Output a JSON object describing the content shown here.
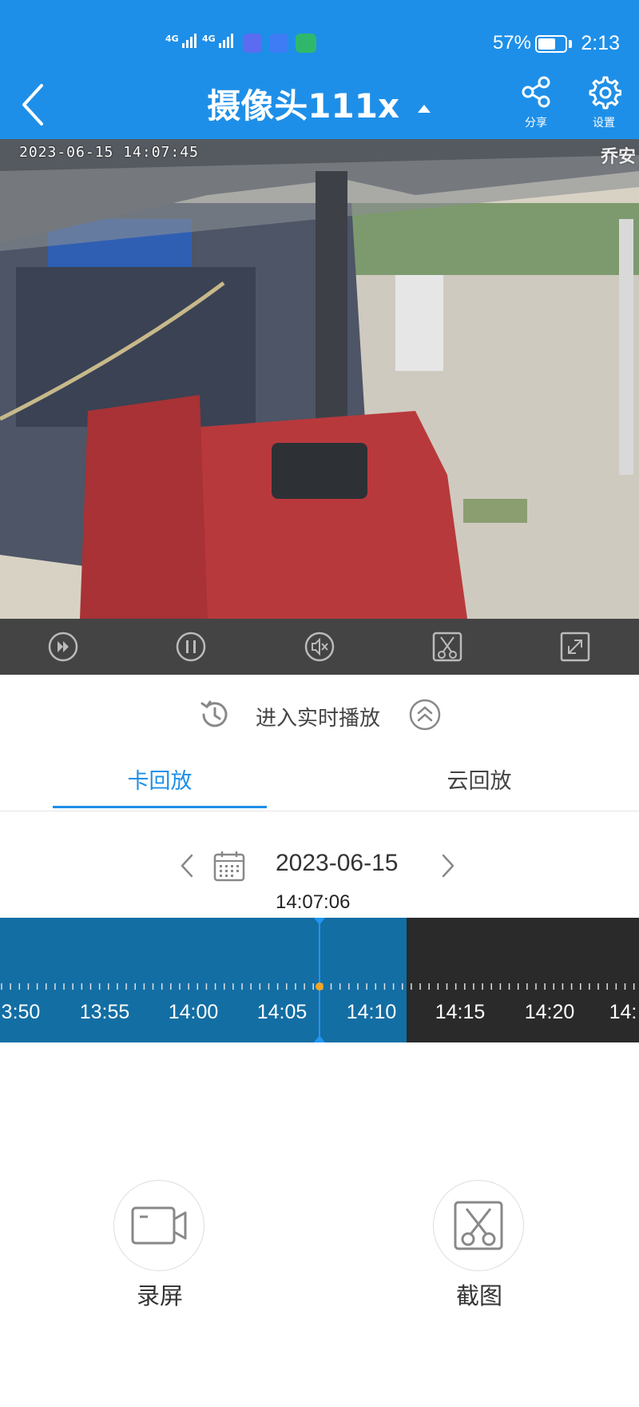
{
  "status_bar": {
    "network_1": "4G",
    "network_2": "4G",
    "battery_percent": "57%",
    "time": "2:13"
  },
  "header": {
    "title": "摄像头111x",
    "share_label": "分享",
    "settings_label": "设置"
  },
  "video": {
    "timestamp": "2023-06-15  14:07:45",
    "watermark": "乔安"
  },
  "live": {
    "label": "进入实时播放"
  },
  "tabs": [
    {
      "label": "卡回放",
      "active": true
    },
    {
      "label": "云回放",
      "active": false
    }
  ],
  "date": {
    "value": "2023-06-15"
  },
  "timeline": {
    "current_time": "14:07:06",
    "labels": [
      "3:50",
      "13:55",
      "14:00",
      "14:05",
      "14:10",
      "14:15",
      "14:20",
      "14:"
    ]
  },
  "actions": {
    "record_label": "录屏",
    "screenshot_label": "截图"
  },
  "colors": {
    "brand_blue": "#1e8fe8",
    "recorded_segment": "#136ea4",
    "control_bar": "#444444",
    "cursor_dot": "#f5a623"
  }
}
